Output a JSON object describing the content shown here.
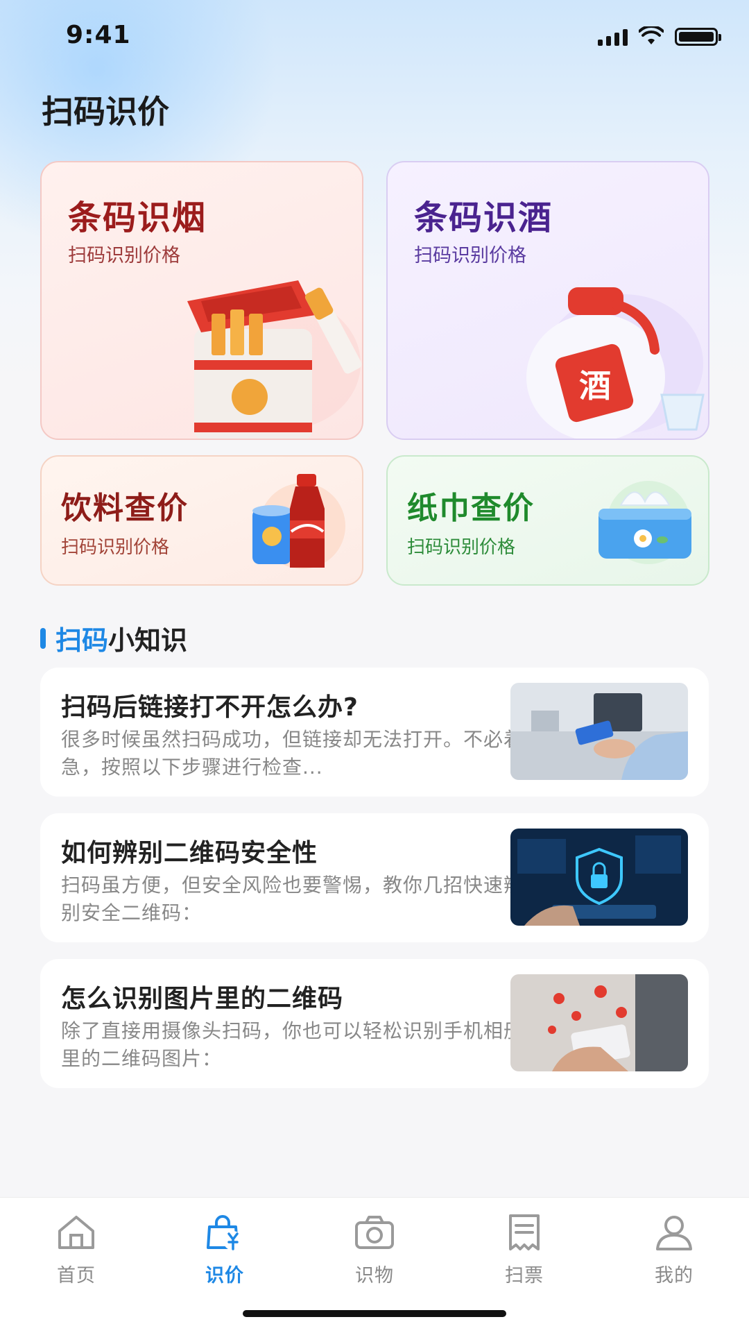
{
  "status_bar": {
    "time": "9:41"
  },
  "page": {
    "title": "扫码识价"
  },
  "cards": [
    {
      "title": "条码识烟",
      "subtitle": "扫码识别价格"
    },
    {
      "title": "条码识酒",
      "subtitle": "扫码识别价格",
      "badge": "酒"
    },
    {
      "title": "饮料查价",
      "subtitle": "扫码识别价格"
    },
    {
      "title": "纸巾查价",
      "subtitle": "扫码识别价格"
    }
  ],
  "section": {
    "accent": "扫码",
    "rest": "小知识"
  },
  "articles": [
    {
      "title": "扫码后链接打不开怎么办?",
      "desc": "很多时候虽然扫码成功，但链接却无法打开。不必着急，按照以下步骤进行检查..."
    },
    {
      "title": "如何辨别二维码安全性",
      "desc": "扫码虽方便，但安全风险也要警惕，教你几招快速辨别安全二维码："
    },
    {
      "title": "怎么识别图片里的二维码",
      "desc": "除了直接用摄像头扫码，你也可以轻松识别手机相册里的二维码图片："
    }
  ],
  "tabbar": [
    {
      "label": "首页",
      "icon": "home-icon"
    },
    {
      "label": "识价",
      "icon": "price-bag-icon",
      "active": true
    },
    {
      "label": "识物",
      "icon": "camera-icon"
    },
    {
      "label": "扫票",
      "icon": "receipt-icon"
    },
    {
      "label": "我的",
      "icon": "user-icon"
    }
  ],
  "colors": {
    "accent": "#1e88e5",
    "cig": "#9b1c1c",
    "liquor": "#4a238f",
    "drink": "#8e1d19",
    "tissue": "#1f8a2c"
  }
}
